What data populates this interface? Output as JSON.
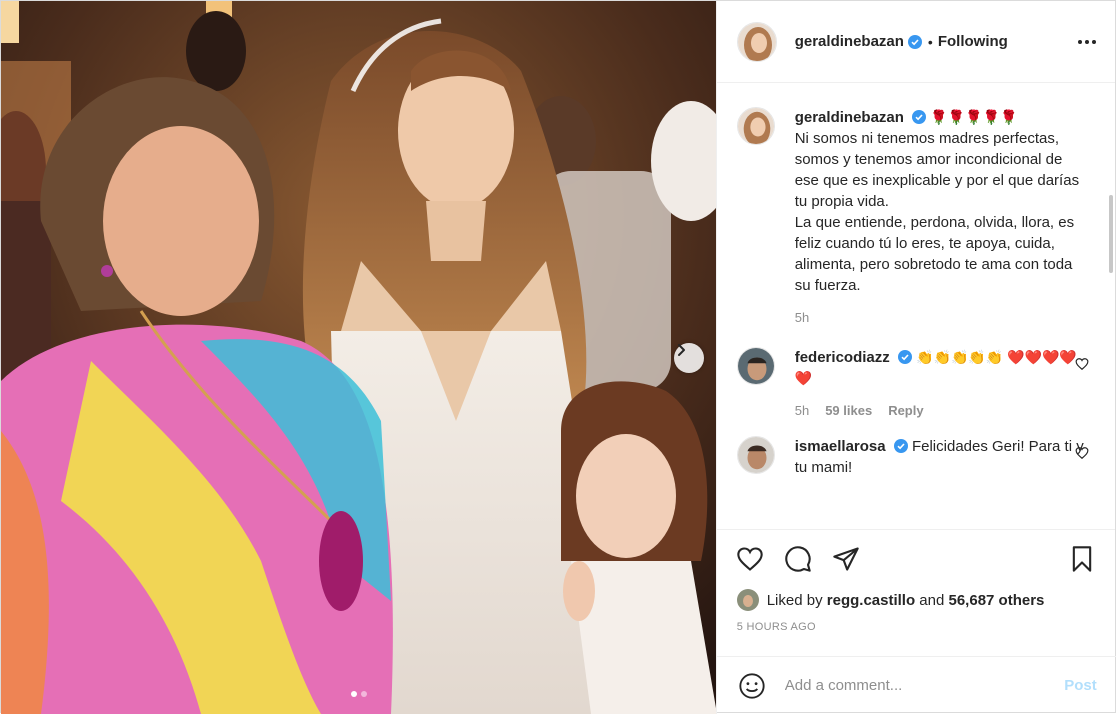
{
  "post": {
    "author": "geraldinebazan",
    "follow_label": "Following",
    "dot_separator": "•",
    "more_icon": "more-horizontal-icon",
    "next_icon": "chevron-right-icon",
    "carousel": {
      "count": 2,
      "active_index": 0
    }
  },
  "caption": {
    "username": "geraldinebazan",
    "emojis": "🌹🌹🌹🌹🌹",
    "text": "Ni somos ni tenemos madres perfectas, somos y tenemos amor incondicional de ese que es inexplicable y por el que darías tu propia vida.\nLa que entiende, perdona, olvida, llora, es feliz cuando tú lo eres, te apoya, cuida, alimenta, pero sobretodo te ama con toda su fuerza.",
    "time": "5h"
  },
  "comments": [
    {
      "username": "federicodiazz",
      "text": "👏👏👏👏👏 ❤️❤️❤️❤️❤️",
      "time": "5h",
      "likes": "59 likes",
      "reply": "Reply"
    },
    {
      "username": "ismaellarosa",
      "text": "Felicidades Geri! Para ti y tu mami!"
    }
  ],
  "likes": {
    "prefix": "Liked by",
    "user": "regg.castillo",
    "middle": "and",
    "others": "56,687 others"
  },
  "timestamp": "5 HOURS AGO",
  "add_comment": {
    "placeholder": "Add a comment...",
    "post_label": "Post"
  },
  "colors": {
    "verified": "#3897f0",
    "post_disabled": "#b2dffc",
    "muted": "#8e8e8e"
  }
}
